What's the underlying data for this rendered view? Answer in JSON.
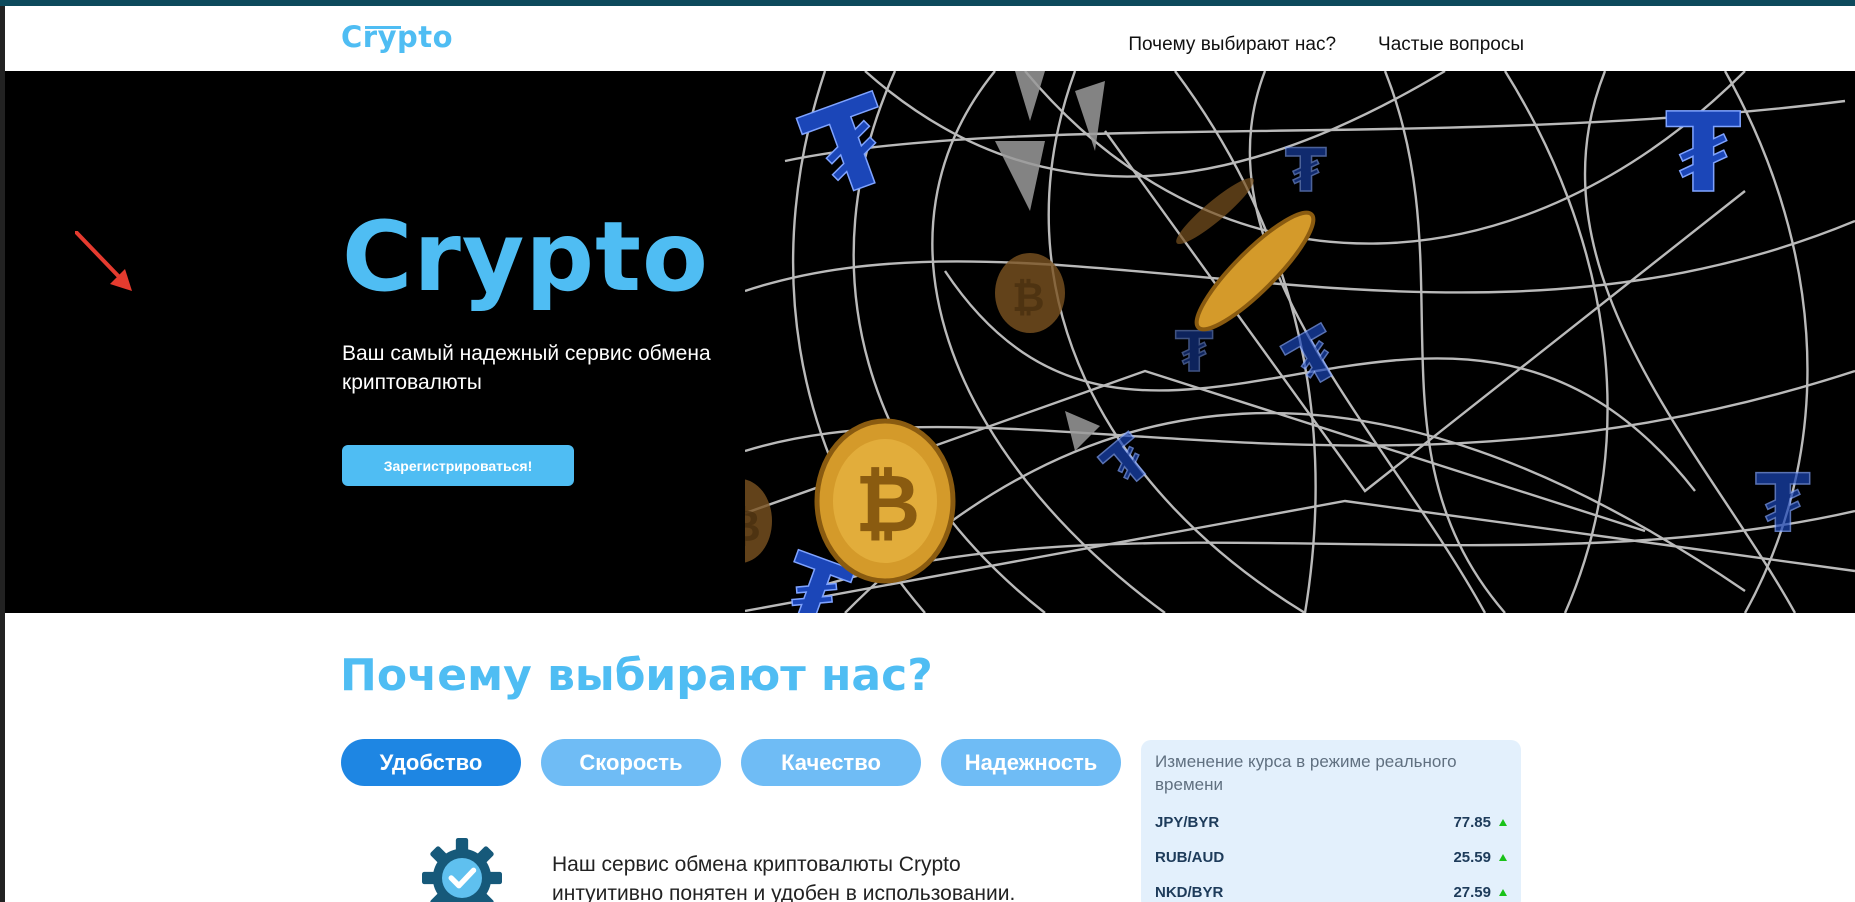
{
  "header": {
    "logo": "Crypto",
    "nav": [
      "Почему выбирают нас?",
      "Частые вопросы"
    ]
  },
  "hero": {
    "title": "Crypto",
    "subtitle": "Ваш самый надежный сервис обмена криптовалюты",
    "button": "Зарегистрироваться!"
  },
  "why": {
    "title": "Почему выбирают нас?",
    "tabs": [
      "Удобство",
      "Скорость",
      "Качество",
      "Надежность"
    ],
    "active_tab": "Удобство",
    "feature_text": "Наш сервис обмена криптовалюты Crypto интуитивно понятен и удобен в использовании."
  },
  "rates": {
    "title": "Изменение курса в режиме реального времени",
    "rows": [
      {
        "pair": "JPY/BYR",
        "value": "77.85",
        "trend": "up"
      },
      {
        "pair": "RUB/AUD",
        "value": "25.59",
        "trend": "up"
      },
      {
        "pair": "NKD/BYR",
        "value": "27.59",
        "trend": "up"
      }
    ]
  },
  "colors": {
    "accent": "#4fbdf3",
    "tab_active": "#1e86e3",
    "tab_inactive": "#6fbcf5",
    "hero_bg": "#000000",
    "topbar": "#0d4a5c",
    "rates_bg": "#e3f0fc",
    "annotation_arrow": "#e53b2f"
  }
}
